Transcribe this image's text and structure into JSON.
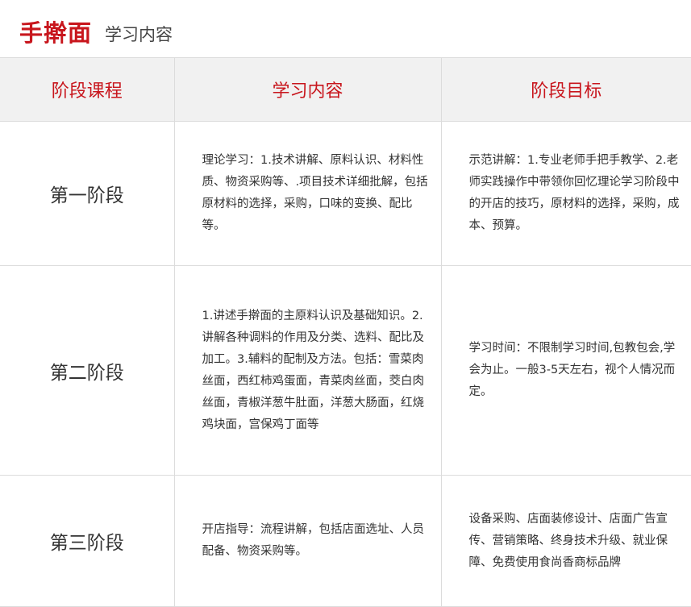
{
  "header": {
    "title": "手擀面",
    "subtitle": "学习内容"
  },
  "table": {
    "columns": [
      "阶段课程",
      "学习内容",
      "阶段目标"
    ],
    "rows": [
      {
        "stage": "第一阶段",
        "content": "理论学习：1.技术讲解、原料认识、材料性质、物资采购等、.项目技术详细批解，包括原材料的选择，采购，口味的变换、配比等。",
        "goal": "示范讲解：1.专业老师手把手教学、2.老师实践操作中带领你回忆理论学习阶段中的开店的技巧，原材料的选择，采购，成本、预算。"
      },
      {
        "stage": "第二阶段",
        "content": "1.讲述手擀面的主原料认识及基础知识。2.讲解各种调料的作用及分类、选料、配比及加工。3.辅料的配制及方法。包括：雪菜肉丝面，西红柿鸡蛋面，青菜肉丝面，茭白肉丝面，青椒洋葱牛肚面，洋葱大肠面，红烧鸡块面，宫保鸡丁面等",
        "goal": "学习时间：不限制学习时间,包教包会,学会为止。一般3-5天左右，视个人情况而定。"
      },
      {
        "stage": "第三阶段",
        "content": "开店指导：流程讲解，包括店面选址、人员配备、物资采购等。",
        "goal": "设备采购、店面装修设计、店面广告宣传、营销策略、终身技术升级、就业保障、免费使用食尚香商标品牌"
      }
    ]
  },
  "colors": {
    "accent": "#c8161d",
    "header_bg": "#f1f1f1",
    "border": "#dcdcdc"
  }
}
